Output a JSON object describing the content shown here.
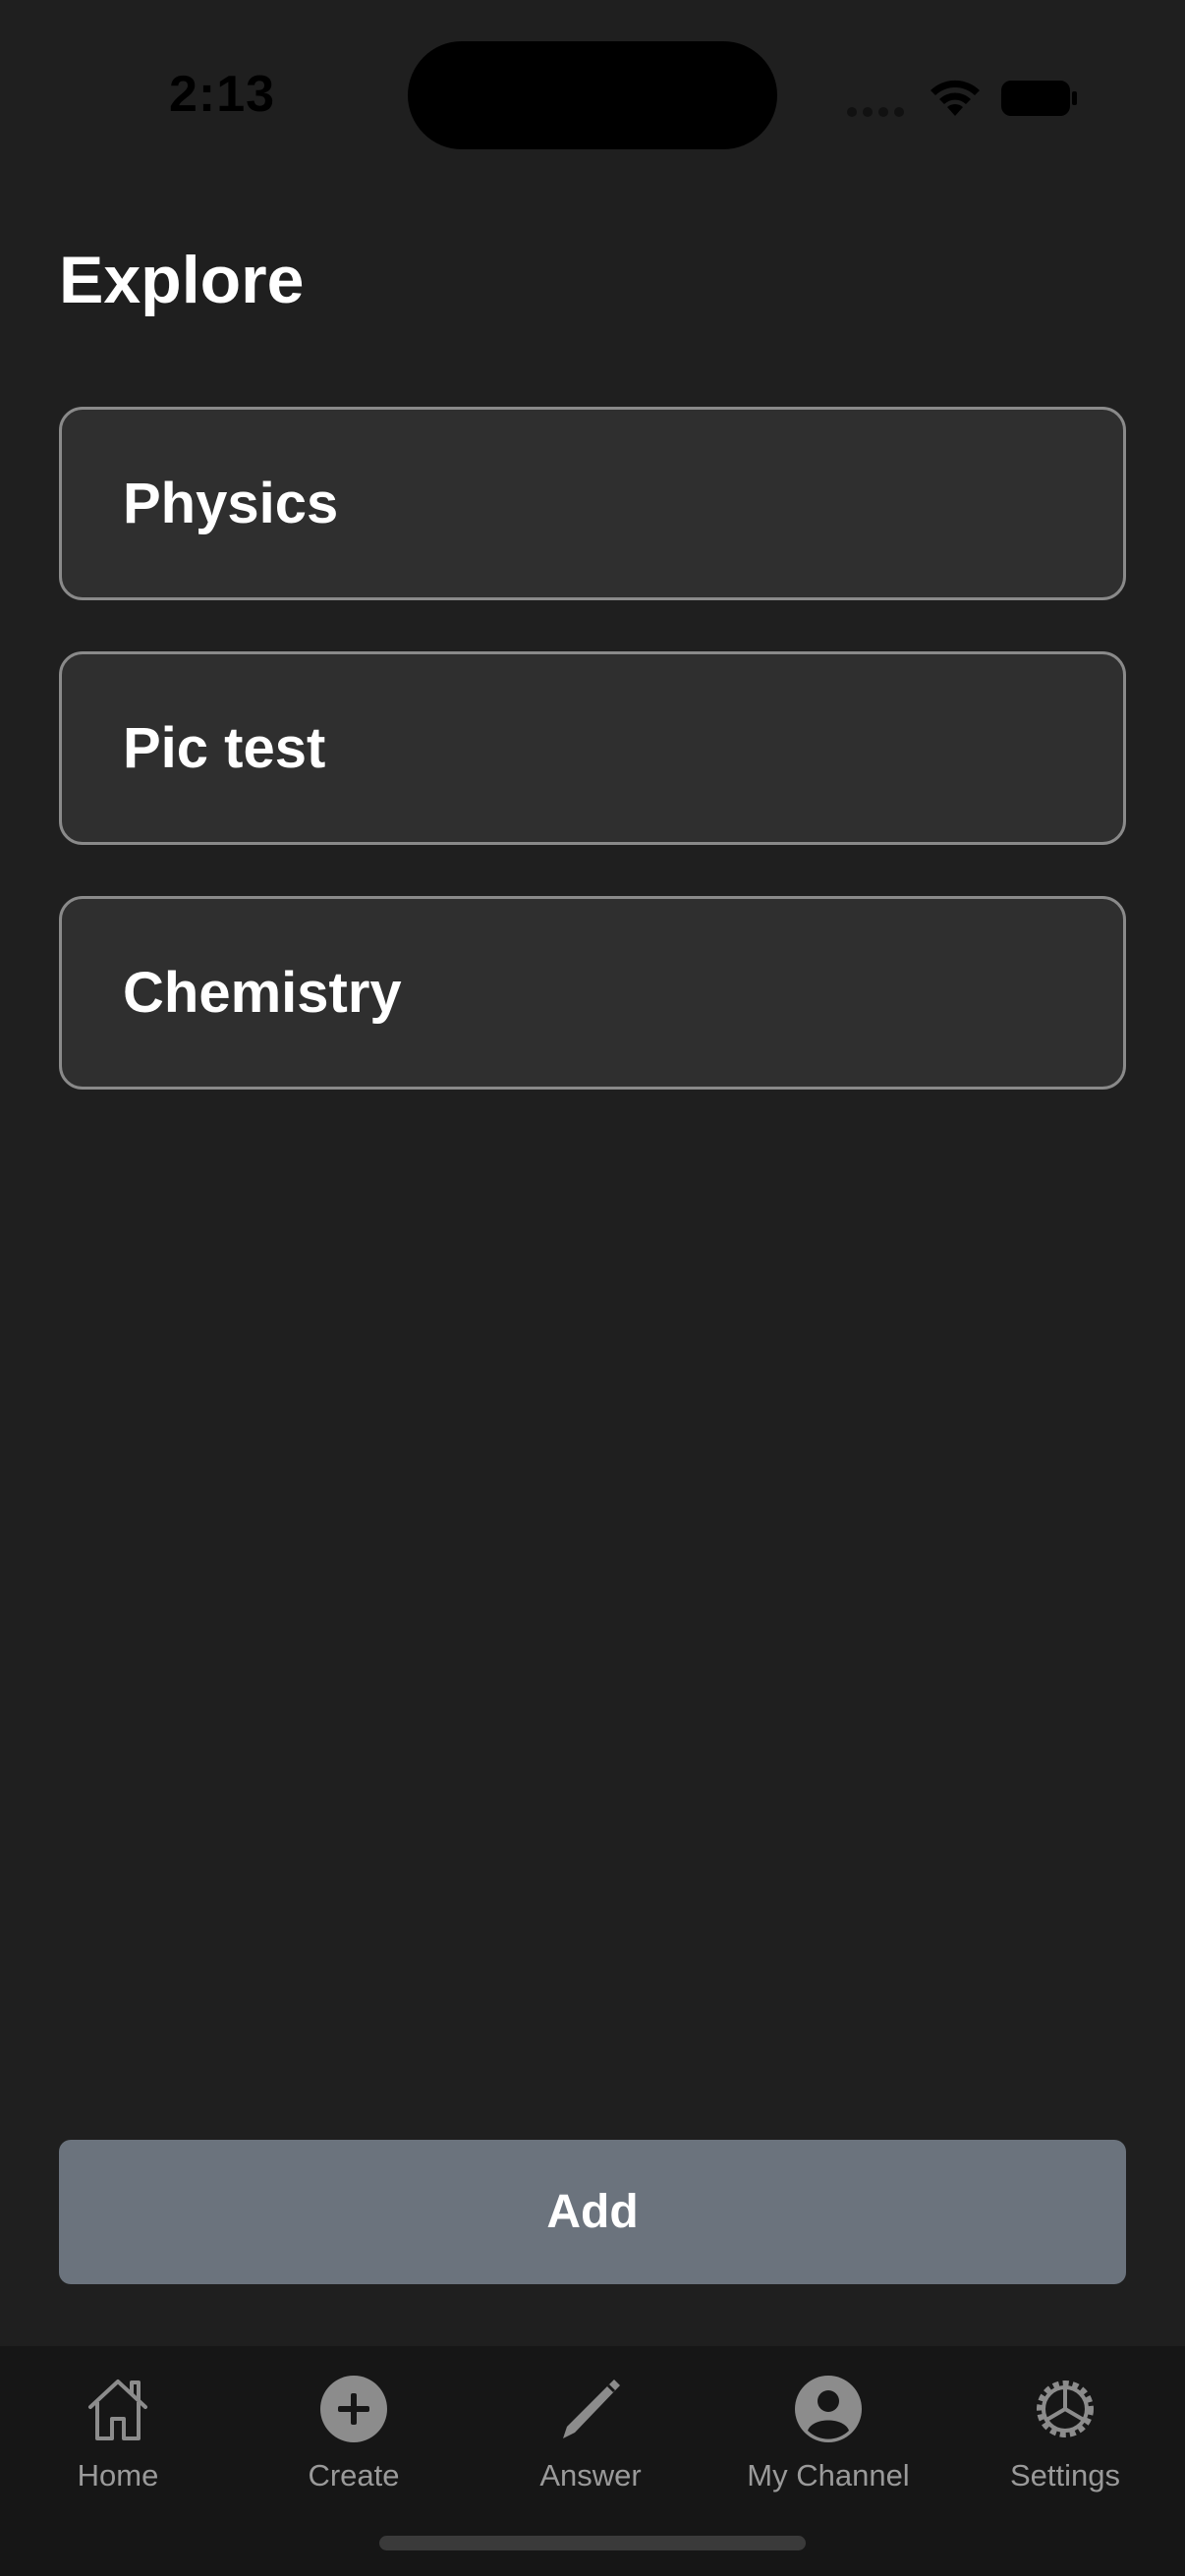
{
  "status_bar": {
    "time": "2:13"
  },
  "page": {
    "title": "Explore"
  },
  "topics": [
    {
      "label": "Physics"
    },
    {
      "label": "Pic test"
    },
    {
      "label": "Chemistry"
    }
  ],
  "actions": {
    "add_label": "Add"
  },
  "tab_bar": {
    "items": [
      {
        "label": "Home",
        "icon": "home-icon"
      },
      {
        "label": "Create",
        "icon": "plus-circle-icon"
      },
      {
        "label": "Answer",
        "icon": "pencil-icon"
      },
      {
        "label": "My Channel",
        "icon": "person-circle-icon"
      },
      {
        "label": "Settings",
        "icon": "gear-icon"
      }
    ]
  },
  "colors": {
    "background": "#1f1f1f",
    "card": "#2f2f2f",
    "card_border": "#8a8a8a",
    "button": "#6b737d",
    "tab_bar": "#161616",
    "tab_inactive": "#9a9a9a"
  }
}
